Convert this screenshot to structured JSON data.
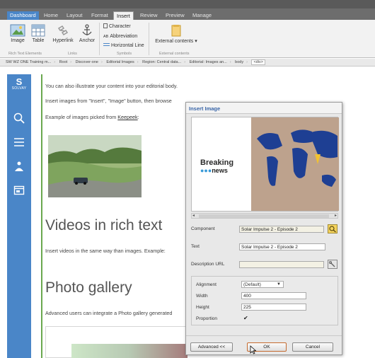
{
  "ribbon": {
    "tabs": [
      "Dashboard",
      "Home",
      "Layout",
      "Format",
      "Insert",
      "Review",
      "Preview",
      "Manage"
    ],
    "active_tab": "Insert",
    "buttons": {
      "image": "Image",
      "table": "Table",
      "hyperlink": "Hyperlink",
      "anchor": "Anchor",
      "character": "Character",
      "abbreviation": "Abbreviation",
      "horizontal_line": "Horizontal Line",
      "external_contents": "External contents ▾",
      "abbr_prefix": "AB"
    },
    "groups": {
      "rich_text": "Rich Text Elements",
      "links": "Links",
      "symbols": "Symbols",
      "external": "External contents"
    }
  },
  "breadcrumb": [
    "SW WZ ONE Training m...",
    "Root",
    "Discover-one",
    "Editorial Images",
    "Region: Central data...",
    "Editorial: Images an...",
    "body",
    "<div>"
  ],
  "nav": {
    "logo_letter": "S",
    "logo_text": "SOLVAY"
  },
  "editor": {
    "p1": "You can also illustrate your content into your editorial body.",
    "p2": "Insert images from \"Insert\", \"Image\" button, then browse",
    "p3_prefix": "Example of images picked from ",
    "p3_link": "Keepeek",
    "p3_suffix": ":",
    "h_videos": "Videos in rich text",
    "p4": "Insert videos in the same way than images. Example:",
    "h_gallery": "Photo gallery",
    "p5": "Advanced users can integrate a Photo gallery generated"
  },
  "dialog": {
    "title": "Insert Image",
    "preview_logo_line1": "Breaking",
    "preview_logo_line2": "news",
    "component_label": "Component",
    "component_value": "Solar Impulse 2 - Episode 2",
    "text_label": "Text",
    "text_value": "Solar Impulse 2 - Episode 2",
    "description_url_label": "Description URL",
    "description_url_value": "",
    "alignment_label": "Alignment",
    "alignment_value": "(Default)",
    "width_label": "Width",
    "width_value": "400",
    "height_label": "Height",
    "height_value": "225",
    "proportion_label": "Proportion",
    "proportion_checked": true,
    "advanced_button": "Advanced <<",
    "ok_button": "OK",
    "cancel_button": "Cancel"
  },
  "colors": {
    "accent_blue": "#4a86c8",
    "editor_border": "#6aa84f",
    "title_blue": "#3a66a8"
  }
}
